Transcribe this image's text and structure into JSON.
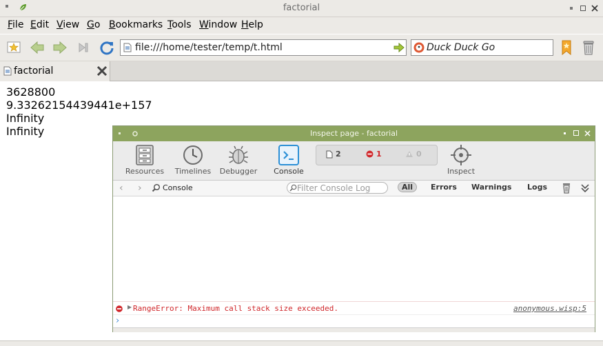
{
  "window": {
    "title": "factorial"
  },
  "menu": [
    {
      "label": "File",
      "key": "F",
      "rest": "ile"
    },
    {
      "label": "Edit",
      "key": "E",
      "rest": "dit"
    },
    {
      "label": "View",
      "key": "V",
      "rest": "iew"
    },
    {
      "label": "Go",
      "key": "G",
      "rest": "o"
    },
    {
      "label": "Bookmarks",
      "key": "B",
      "rest": "ookmarks"
    },
    {
      "label": "Tools",
      "key": "T",
      "rest": "ools"
    },
    {
      "label": "Window",
      "key": "W",
      "rest": "indow"
    },
    {
      "label": "Help",
      "key": "H",
      "rest": "elp"
    }
  ],
  "toolbar": {
    "url": "file:///home/tester/temp/t.html",
    "search_engine": "Duck Duck Go"
  },
  "tab": {
    "label": "factorial"
  },
  "page": {
    "lines": [
      "3628800",
      "9.33262154439441e+157",
      "Infinity",
      "Infinity"
    ]
  },
  "inspector": {
    "title": "Inspect page - factorial",
    "tools": [
      "Resources",
      "Timelines",
      "Debugger",
      "Console",
      "Inspect"
    ],
    "counts": {
      "resources": "2",
      "errors": "1",
      "warnings": "0"
    },
    "breadcrumb": "Console",
    "filter_placeholder": "Filter Console Log",
    "scopes": [
      "All",
      "Errors",
      "Warnings",
      "Logs"
    ],
    "error": {
      "message": "RangeError: Maximum call stack size exceeded.",
      "source": "anonymous.wisp:5"
    }
  },
  "colors": {
    "chrome": "#eceae6",
    "inspector_titlebar": "#8da45e",
    "error": "#d0262a",
    "console_active": "#2b8fd6"
  }
}
